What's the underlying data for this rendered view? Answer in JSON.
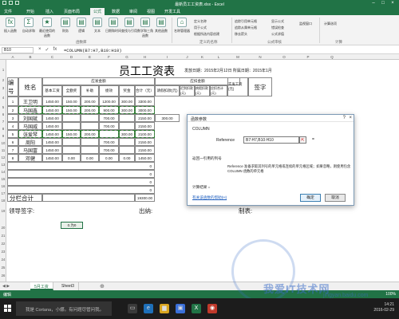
{
  "window": {
    "title": "最新员工工资表.xlsx - Excel"
  },
  "ribbon_tabs": [
    "文件",
    "开始",
    "插入",
    "页面布局",
    "公式",
    "数据",
    "审阅",
    "视图",
    "开发工具"
  ],
  "ribbon": {
    "buttons": [
      "插入函数",
      "自动求和",
      "最近使用的函数",
      "财务",
      "逻辑",
      "文本",
      "日期和时间",
      "查找与引用",
      "数学和三角函数",
      "其他函数",
      "名称管理器"
    ],
    "small": [
      "定义名称",
      "用于公式",
      "根据所选内容创建",
      "追踪引用单元格",
      "追踪从属单元格",
      "移去箭头",
      "显示公式",
      "错误检查",
      "公式求值",
      "监视窗口",
      "计算选项"
    ],
    "groups": [
      "函数库",
      "定义的名称",
      "公式审核",
      "计算"
    ]
  },
  "formula_bar": {
    "name_box": "B10",
    "formula": "=COLUMN(B7:H7,B10:H10)",
    "icons": [
      "×",
      "✓",
      "fx"
    ]
  },
  "columns": [
    "A",
    "B",
    "C",
    "D",
    "E",
    "F",
    "G",
    "H",
    "I",
    "J",
    "K",
    "L",
    "M",
    "N",
    "O",
    "P",
    "Q"
  ],
  "rows": [
    "1",
    "2",
    "3",
    "4",
    "5",
    "6",
    "7",
    "8",
    "9",
    "10",
    "11",
    "12",
    "13",
    "14",
    "15",
    "16",
    "17",
    "18",
    "19",
    "20",
    "21",
    "22",
    "23",
    "24",
    "25",
    "26"
  ],
  "sheet": {
    "title": "员工工资表",
    "issue_date": "发放日期：2015年2月12日 所属日期：2015年1月",
    "h_num": "编号",
    "h_name": "姓名",
    "h_group1": "应发金额",
    "h_group2": "应扣金额",
    "h_base": "基本工资",
    "h_bonus": "全勤奖",
    "h_allow": "补助",
    "h_perf": "绩效",
    "h_award": "奖金",
    "h_total": "合计（元）",
    "h_leave": "请假扣款(元)",
    "h_late": "迟到扣款(元)",
    "h_sick": "病假扣款(元)",
    "h_dtotal": "应扣合计(元)",
    "h_pay": "实发工资(元)",
    "h_sign": "签字",
    "rows": [
      {
        "no": "1",
        "name": "王卫明",
        "c1": "1450.00",
        "c2": "150.00",
        "c3": "200.00",
        "c4": "1200.00",
        "c5": "300.00",
        "c6": "3300.00"
      },
      {
        "no": "2",
        "name": "马国鑫",
        "c1": "1450.00",
        "c2": "150.00",
        "c3": "200.00",
        "c4": "900.00",
        "c5": "300.00",
        "c6": "3000.00"
      },
      {
        "no": "3",
        "name": "刘国斌",
        "c1": "1450.00",
        "c2": "",
        "c3": "",
        "c4": "700.00",
        "c5": "",
        "c6": "2150.00",
        "leave": "300.00"
      },
      {
        "no": "4",
        "name": "马国威",
        "c1": "1450.00",
        "c2": "",
        "c3": "",
        "c4": "700.00",
        "c5": "",
        "c6": "2150.00"
      },
      {
        "no": "5",
        "name": "张爱琴",
        "c1": "1450.00",
        "c2": "150.00",
        "c3": "200.00",
        "c4": "",
        "c5": "300.00",
        "c6": "2100.00"
      },
      {
        "no": "6",
        "name": "周阳",
        "c1": "1450.00",
        "c2": "",
        "c3": "",
        "c4": "700.00",
        "c5": "",
        "c6": "2150.00"
      },
      {
        "no": "7",
        "name": "马国富",
        "c1": "1450.00",
        "c2": "",
        "c3": "",
        "c4": "700.00",
        "c5": "",
        "c6": "2150.00"
      },
      {
        "no": "8",
        "name": "邓健",
        "c1": "1450.00",
        "c2": "0.00",
        "c3": "0.00",
        "c4": "0.00",
        "c5": "0.00",
        "c6": "1450.00"
      }
    ],
    "zeros": [
      "0",
      "0",
      "0",
      "0"
    ],
    "subtotal_label": "分栏合计",
    "subtotal_value": "19300.00",
    "sign_leader": "领导签字:",
    "sign_cashier": "出纳:",
    "sign_maker": "制表:",
    "selected_cell": "0.为0"
  },
  "dialog": {
    "title": "函数参数",
    "function": "COLUMN",
    "ref_label": "Reference",
    "ref_value": "B7:H7,B10:H10",
    "collapse_icon": "⇱",
    "eq": "=",
    "description": "返回一引用的列号",
    "arg_desc": "Reference 准备求取其列号的单元格或连续的单元格区域；如果忽略，则使用包含 COLUMN 函数的单元格",
    "result_label": "计算结果 =",
    "help_link": "有关该函数的帮助(H)",
    "ok": "确定",
    "cancel": "取消",
    "close": "×",
    "qmark": "?"
  },
  "sheet_tabs": {
    "nav": "◀ ▶",
    "tabs": [
      "5月工资",
      "Sheet3"
    ],
    "add": "⊕"
  },
  "status": {
    "mode": "编辑",
    "zoom": "100%"
  },
  "taskbar": {
    "search": "我是 Cortana，小娜。有问题尽管问我。",
    "time": "14:21",
    "date": "2016-02-29"
  },
  "watermark": {
    "main": "我爱IT技术网",
    "sub": "jingyan.baidu.com"
  },
  "colors": {
    "excel_green": "#217346",
    "selection_dash": "#2e7d32"
  }
}
